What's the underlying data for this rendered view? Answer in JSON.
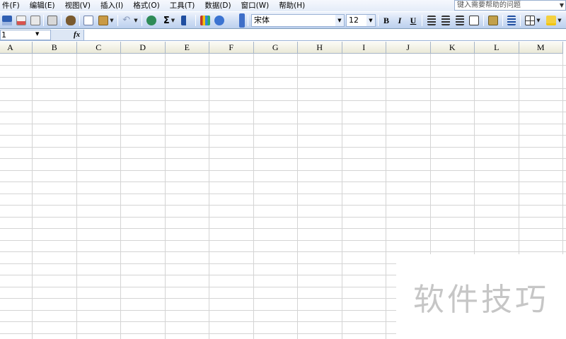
{
  "menubar": {
    "items": [
      "件(F)",
      "编辑(E)",
      "视图(V)",
      "插入(I)",
      "格式(O)",
      "工具(T)",
      "数据(D)",
      "窗口(W)",
      "帮助(H)"
    ],
    "help_placeholder": "键入需要帮助的问题"
  },
  "toolbar": {
    "font_name": "宋体",
    "font_size": "12",
    "bold_label": "B",
    "italic_label": "I",
    "underline_label": "U",
    "sum_label": "Σ"
  },
  "formula_bar": {
    "name_box_value": "1",
    "fx_label": "fx"
  },
  "sheet": {
    "columns": [
      "A",
      "B",
      "C",
      "D",
      "E",
      "F",
      "G",
      "H",
      "I",
      "J",
      "K",
      "L",
      "M"
    ]
  },
  "watermark": {
    "text": "软件技巧"
  },
  "colors": {
    "toolbar_blue": "#cddcf3",
    "header_beige": "#ebe9d8",
    "gridline": "#d4d4d4"
  }
}
